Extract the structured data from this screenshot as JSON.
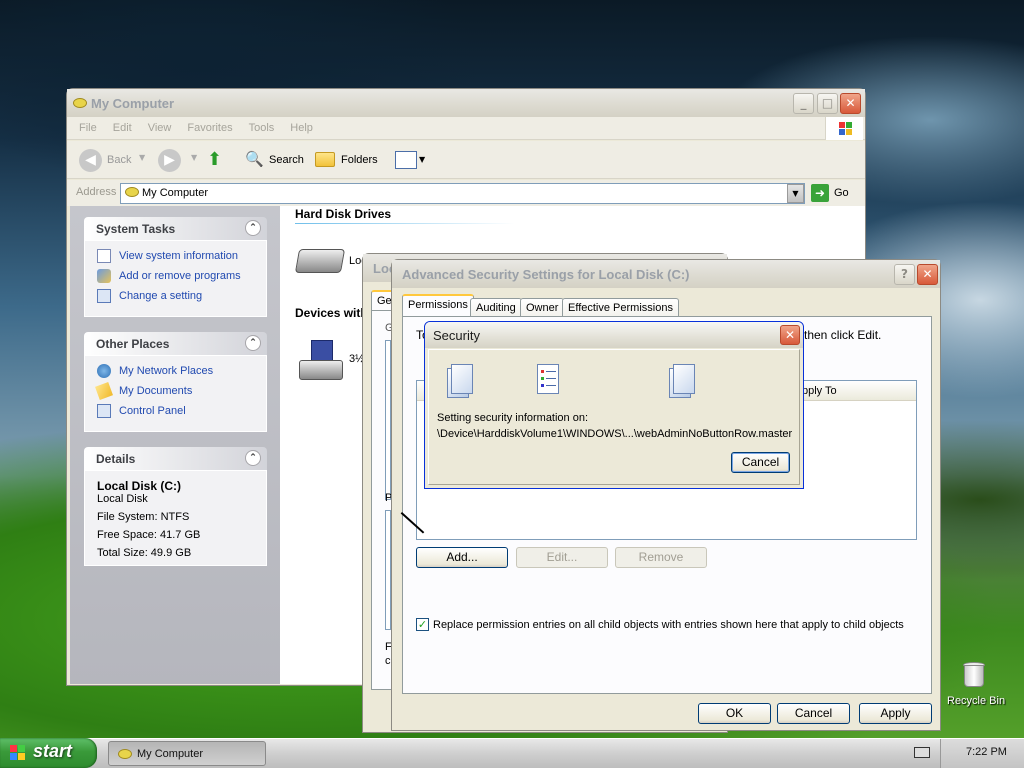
{
  "my_computer": {
    "title": "My Computer",
    "menu": [
      "File",
      "Edit",
      "View",
      "Favorites",
      "Tools",
      "Help"
    ],
    "toolbar": {
      "back": "Back",
      "search": "Search",
      "folders": "Folders"
    },
    "address": {
      "label": "Address",
      "value": "My Computer",
      "go": "Go"
    },
    "system_tasks": {
      "header": "System Tasks",
      "items": [
        "View system information",
        "Add or remove programs",
        "Change a setting"
      ]
    },
    "other_places": {
      "header": "Other Places",
      "items": [
        "My Network Places",
        "My Documents",
        "Control Panel"
      ]
    },
    "details": {
      "header": "Details",
      "name": "Local Disk (C:)",
      "type": "Local Disk",
      "fs": "File System: NTFS",
      "free": "Free Space: 41.7 GB",
      "total": "Total Size: 49.9 GB"
    },
    "sections": {
      "hdd": "Hard Disk Drives",
      "removable": "Devices with",
      "disk_label": "Loc",
      "floppy_label": "3½"
    }
  },
  "props_dialog": {
    "title": "Loc",
    "tab": "Ge",
    "labels": [
      "G",
      "Pe",
      "P",
      "P",
      "F",
      "c"
    ]
  },
  "adv_security": {
    "title": "Advanced Security Settings for Local Disk (C:)",
    "tabs": [
      "Permissions",
      "Auditing",
      "Owner",
      "Effective Permissions"
    ],
    "intro_left": "To",
    "intro_right": "then click Edit.",
    "column": "pply To",
    "buttons": {
      "add": "Add...",
      "edit": "Edit...",
      "remove": "Remove"
    },
    "checkbox_label": "Replace permission entries on all child objects with entries shown here that apply to child objects",
    "footer": {
      "ok": "OK",
      "cancel": "Cancel",
      "apply": "Apply"
    }
  },
  "security_progress": {
    "title": "Security",
    "line1": "Setting security information on:",
    "line2": "\\Device\\HarddiskVolume1\\WINDOWS\\...\\webAdminNoButtonRow.master",
    "cancel": "Cancel"
  },
  "desktop": {
    "recycle_bin": "Recycle Bin"
  },
  "taskbar": {
    "start": "start",
    "task": "My Computer",
    "clock": "7:22 PM"
  }
}
